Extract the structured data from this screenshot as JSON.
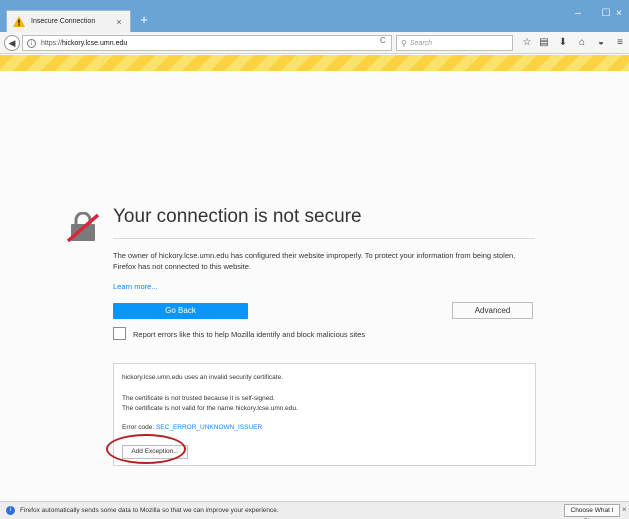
{
  "tab": {
    "title": "Insecure Connection",
    "close": "×",
    "new_tab": "+"
  },
  "window": {
    "minimize": "–",
    "maximize": "☐",
    "close": "×"
  },
  "nav": {
    "back": "◀",
    "url_prefix": "https://",
    "url_host": "hickory.lcse.umn.edu",
    "reload": "C",
    "search_icon": "⚲",
    "search_placeholder": "Search",
    "toolbar_icons": [
      "bookmark-star-icon",
      "library-icon",
      "download-icon",
      "home-icon",
      "pocket-icon",
      "menu-icon"
    ]
  },
  "error": {
    "title": "Your connection is not secure",
    "description": "The owner of hickory.lcse.umn.edu has configured their website improperly. To protect your information from being stolen, Firefox has not connected to this website.",
    "learn_more": "Learn more...",
    "go_back": "Go Back",
    "advanced": "Advanced",
    "report_label": "Report errors like this to help Mozilla identify and block malicious sites"
  },
  "details": {
    "line1": "hickory.lcse.umn.edu uses an invalid security certificate.",
    "line2": "The certificate is not trusted because it is self-signed.",
    "line3": "The certificate is not valid for the name hickory.lcse.umn.edu.",
    "error_code_label": "Error code:",
    "error_code": "SEC_ERROR_UNKNOWN_ISSUER",
    "add_exception": "Add Exception..."
  },
  "notification": {
    "text": "Firefox automatically sends some data to Mozilla so that we can improve your experience.",
    "share_button": "Choose What I Share",
    "close": "×"
  },
  "colors": {
    "accent": "#0996f8",
    "highlight": "#b22222",
    "stripe": "#fdd23f"
  }
}
